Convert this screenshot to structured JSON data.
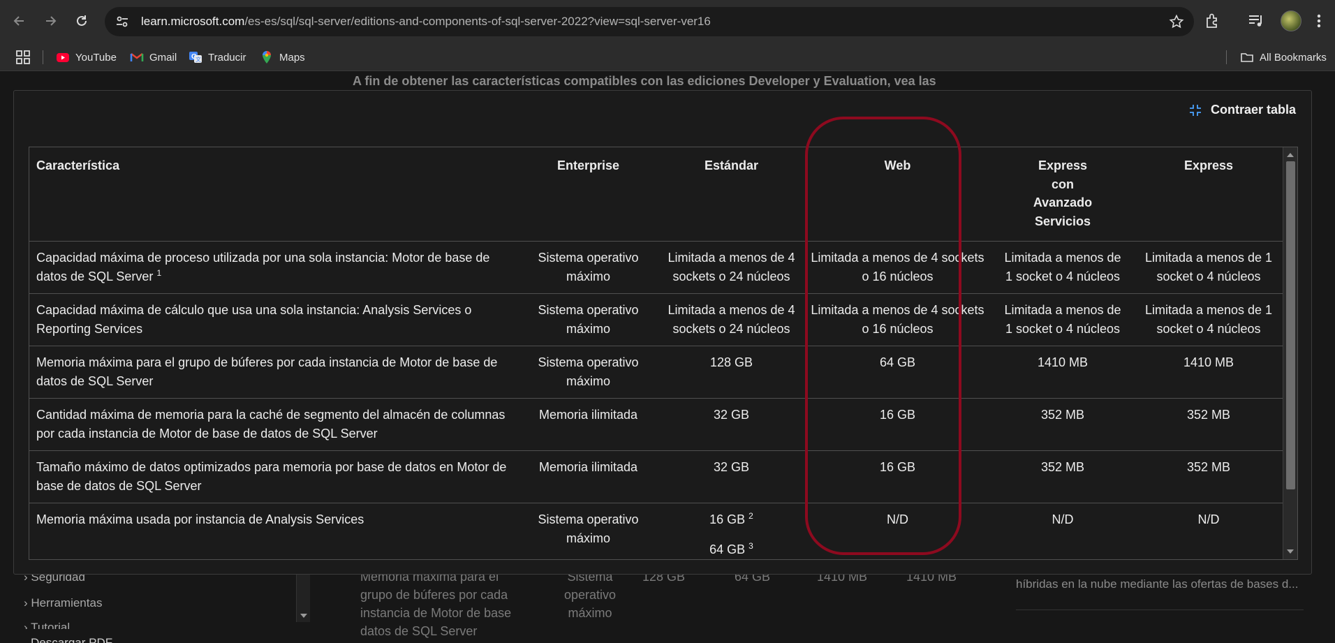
{
  "browser": {
    "url_host": "learn.microsoft.com",
    "url_path": "/es-es/sql/sql-server/editions-and-components-of-sql-server-2022?view=sql-server-ver16",
    "bookmarks": [
      {
        "label": "YouTube",
        "icon": "youtube-icon"
      },
      {
        "label": "Gmail",
        "icon": "gmail-icon"
      },
      {
        "label": "Traducir",
        "icon": "translate-icon"
      },
      {
        "label": "Maps",
        "icon": "maps-icon"
      }
    ],
    "all_bookmarks_label": "All Bookmarks"
  },
  "page": {
    "intro_text": "A fin de obtener las características compatibles con las ediciones Developer y Evaluation, vea las",
    "sidebar": {
      "items": [
        "Seguridad",
        "Herramientas",
        "Tutorial"
      ],
      "download_pdf": "Descargar PDF"
    },
    "bg_table": {
      "feature": [
        "Memoria máxima para el",
        "grupo de búferes por cada",
        "instancia de Motor de base",
        "datos de SQL Server"
      ],
      "enterprise": [
        "Sistema",
        "operativo",
        "máximo"
      ],
      "standard": "128 GB",
      "web": "64 GB",
      "express_adv": "1410 MB",
      "express": "1410 MB"
    },
    "right_panel_text": "híbridas en la nube mediante las ofertas de bases d..."
  },
  "table": {
    "collapse_label": "Contraer tabla",
    "headers": {
      "feature": "Característica",
      "enterprise": "Enterprise",
      "standard": "Estándar",
      "web": "Web",
      "express_adv": [
        "Express",
        "con",
        "Avanzado",
        "Servicios"
      ],
      "express": "Express"
    },
    "rows": [
      {
        "feature": "Capacidad máxima de proceso utilizada por una sola instancia: Motor de base de datos de SQL Server",
        "feature_sup": "1",
        "enterprise": "Sistema operativo máximo",
        "standard": "Limitada a menos de 4 sockets o 24 núcleos",
        "web": "Limitada a menos de 4 sockets o 16 núcleos",
        "express_adv": "Limitada a menos de 1 socket o 4 núcleos",
        "express": "Limitada a menos de 1 socket o 4 núcleos"
      },
      {
        "feature": "Capacidad máxima de cálculo que usa una sola instancia: Analysis Services o Reporting Services",
        "enterprise": "Sistema operativo máximo",
        "standard": "Limitada a menos de 4 sockets o 24 núcleos",
        "web": "Limitada a menos de 4 sockets o 16 núcleos",
        "express_adv": "Limitada a menos de 1 socket o 4 núcleos",
        "express": "Limitada a menos de 1 socket o 4 núcleos"
      },
      {
        "feature": "Memoria máxima para el grupo de búferes por cada instancia de Motor de base de datos de SQL Server",
        "enterprise": "Sistema operativo máximo",
        "standard": "128 GB",
        "web": "64 GB",
        "express_adv": "1410 MB",
        "express": "1410 MB"
      },
      {
        "feature": "Cantidad máxima de memoria para la caché de segmento del almacén de columnas por cada instancia de Motor de base de datos de SQL Server",
        "enterprise": "Memoria ilimitada",
        "standard": "32 GB",
        "web": "16 GB",
        "express_adv": "352 MB",
        "express": "352 MB"
      },
      {
        "feature": "Tamaño máximo de datos optimizados para memoria por base de datos en Motor de base de datos de SQL Server",
        "enterprise": "Memoria ilimitada",
        "standard": "32 GB",
        "web": "16 GB",
        "express_adv": "352 MB",
        "express": "352 MB"
      },
      {
        "feature": "Memoria máxima usada por instancia de Analysis Services",
        "enterprise": "Sistema operativo máximo",
        "standard_1": "16 GB",
        "standard_1_sup": "2",
        "standard_2": "64 GB",
        "standard_2_sup": "3",
        "web": "N/D",
        "express_adv": "N/D",
        "express": "N/D"
      }
    ]
  },
  "colors": {
    "highlight_ring": "#8d0a1f",
    "accent_icon": "#4aa3ff"
  }
}
